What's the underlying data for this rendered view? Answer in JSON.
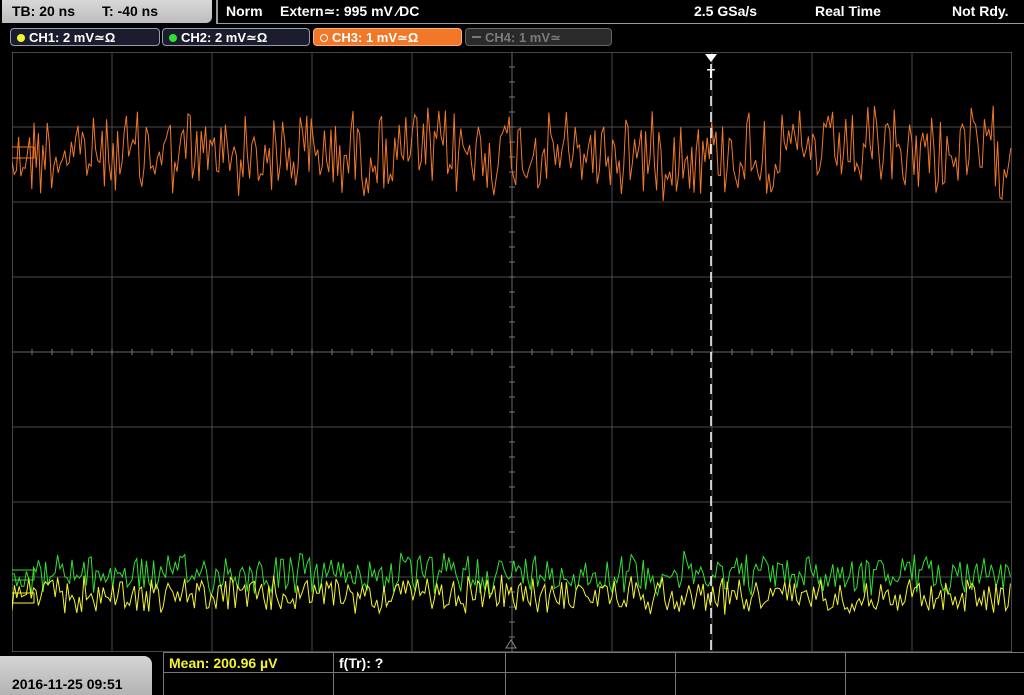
{
  "topbar": {
    "timebase": "TB: 20 ns",
    "trigger_offset": "T: -40 ns",
    "mode": "Norm",
    "trigger_source": "Extern≃: 995 mV ∕DC",
    "sample_rate": "2.5 GSa/s",
    "acq_mode": "Real Time",
    "status": "Not Rdy."
  },
  "channels": [
    {
      "label": "CH1: 2 mV≃Ω",
      "color": "#f4f430",
      "state": "on"
    },
    {
      "label": "CH2: 2 mV≃Ω",
      "color": "#30e030",
      "state": "on"
    },
    {
      "label": "CH3: 1 mV≃Ω",
      "color": "#f07828",
      "state": "selected"
    },
    {
      "label": "CH4: 1 mV≃",
      "color": "#7a7a7a",
      "state": "off"
    }
  ],
  "trigger_marker": "T",
  "bottom": {
    "datetime": "2016-11-25 09:51",
    "mean_label": "Mean: 200.96 µV",
    "freq_label": "f(Tr): ?"
  },
  "colors": {
    "ch1": "#f4f430",
    "ch2": "#30e030",
    "ch3": "#f07828",
    "grid": "#4a4a4a",
    "trigger_line": "#ffffff"
  }
}
